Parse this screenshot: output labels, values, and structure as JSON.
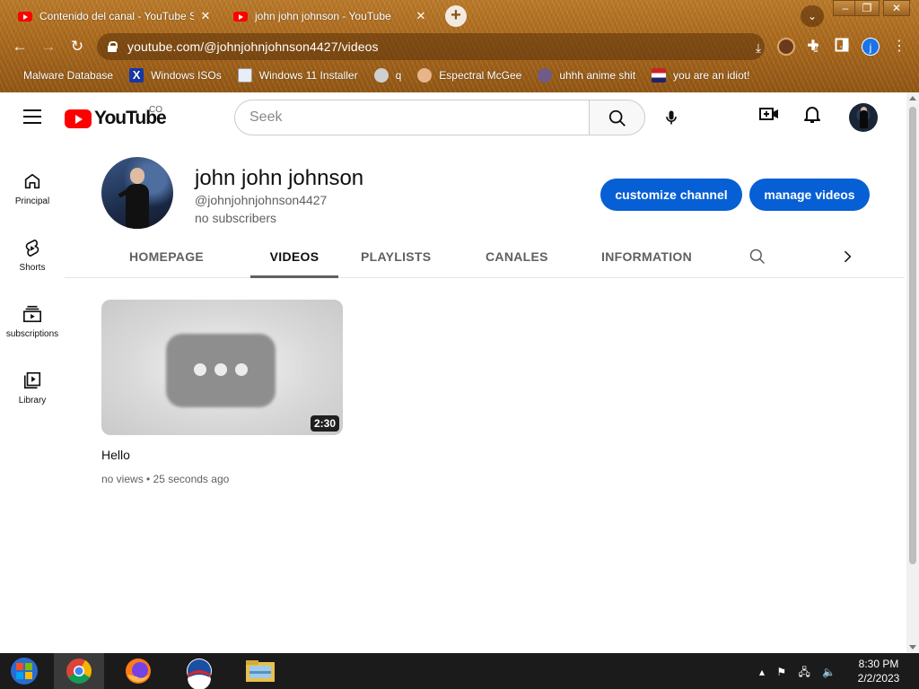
{
  "browser": {
    "tabs": [
      {
        "title": "Contenido del canal - YouTube Studio",
        "active": false
      },
      {
        "title": "john john johnson - YouTube",
        "active": true
      }
    ],
    "new_tab": "+",
    "url": "youtube.com/@johnjohnjohnson4427/videos",
    "profile_initial": "j",
    "bookmarks": [
      {
        "label": "Malware Database",
        "icon": "blank"
      },
      {
        "label": "Windows ISOs",
        "icon": "xbox-x-icon"
      },
      {
        "label": "Windows 11 Installer",
        "icon": "installer-icon"
      },
      {
        "label": "q",
        "icon": "cube-icon"
      },
      {
        "label": "Espectral McGee",
        "icon": "face-icon"
      },
      {
        "label": "uhhh anime shit",
        "icon": "anime-icon"
      },
      {
        "label": "you are an idiot!",
        "icon": "flag-icon"
      }
    ],
    "window_buttons": {
      "minimize": "–",
      "maximize": "❐",
      "close": "✕"
    }
  },
  "youtube": {
    "logo_text": "YouTube",
    "country_code": "CO",
    "search_placeholder": "Seek",
    "guide": [
      {
        "label": "Principal",
        "icon": "home-icon"
      },
      {
        "label": "Shorts",
        "icon": "shorts-icon"
      },
      {
        "label": "subscriptions",
        "icon": "subscriptions-icon"
      },
      {
        "label": "Library",
        "icon": "library-icon"
      }
    ],
    "channel": {
      "name": "john john johnson",
      "handle": "@johnjohnjohnson4427",
      "subscribers": "no subscribers",
      "customize_label": "customize channel",
      "manage_label": "manage videos"
    },
    "tabs": [
      {
        "label": "HOMEPAGE",
        "active": false
      },
      {
        "label": "VIDEOS",
        "active": true
      },
      {
        "label": "PLAYLISTS",
        "active": false
      },
      {
        "label": "CANALES",
        "active": false
      },
      {
        "label": "INFORMATION",
        "active": false
      }
    ],
    "videos": [
      {
        "title": "Hello",
        "duration": "2:30",
        "views": "no views",
        "age": "25 seconds ago",
        "meta": "no views • 25 seconds ago"
      }
    ],
    "colors": {
      "accent": "#065fd4",
      "brand_red": "#ff0000"
    }
  },
  "taskbar": {
    "apps": [
      "start-orb-icon",
      "chrome-icon",
      "firefox-icon",
      "obama-icon",
      "file-explorer-icon"
    ],
    "time": "8:30 PM",
    "date": "2/2/2023"
  }
}
